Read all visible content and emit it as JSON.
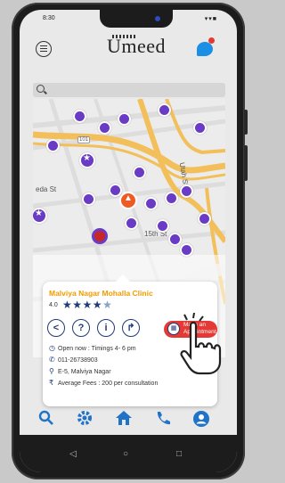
{
  "status": {
    "time": "8:30",
    "icons": "▾▾■"
  },
  "app": {
    "title": "Umeed"
  },
  "clinic": {
    "name": "Malviya Nagar Mohalla Clinic",
    "rating": "4.0",
    "stars_filled": 4,
    "stars_total": 5,
    "make_appointment_label": "Make an Appointment",
    "hours": "Open now : Timings 4- 6 pm",
    "phone": "011-26738903",
    "address": "E-5, Malviya Nagar",
    "fees": "Average Fees : 200 per consultation"
  },
  "map": {
    "street_labels": [
      "eda St",
      "15th St",
      "Utah St"
    ],
    "highway_label": "101"
  },
  "icons": {
    "menu": "menu-icon",
    "chat": "chat-icon",
    "search": "search-icon",
    "share": "share-icon",
    "help": "help-icon",
    "info": "info-icon",
    "directions": "directions-icon",
    "calendar": "calendar-icon",
    "clock": "clock-icon",
    "phone": "phone-icon",
    "location": "location-icon",
    "rupee": "rupee-icon",
    "nav": [
      "search-icon",
      "settings-icon",
      "home-icon",
      "phone-icon",
      "profile-icon"
    ]
  },
  "colors": {
    "accent": "#1f73c8",
    "pin": "#6a3bc4",
    "title_orange": "#f29b00",
    "appointment_red": "#e53935"
  }
}
